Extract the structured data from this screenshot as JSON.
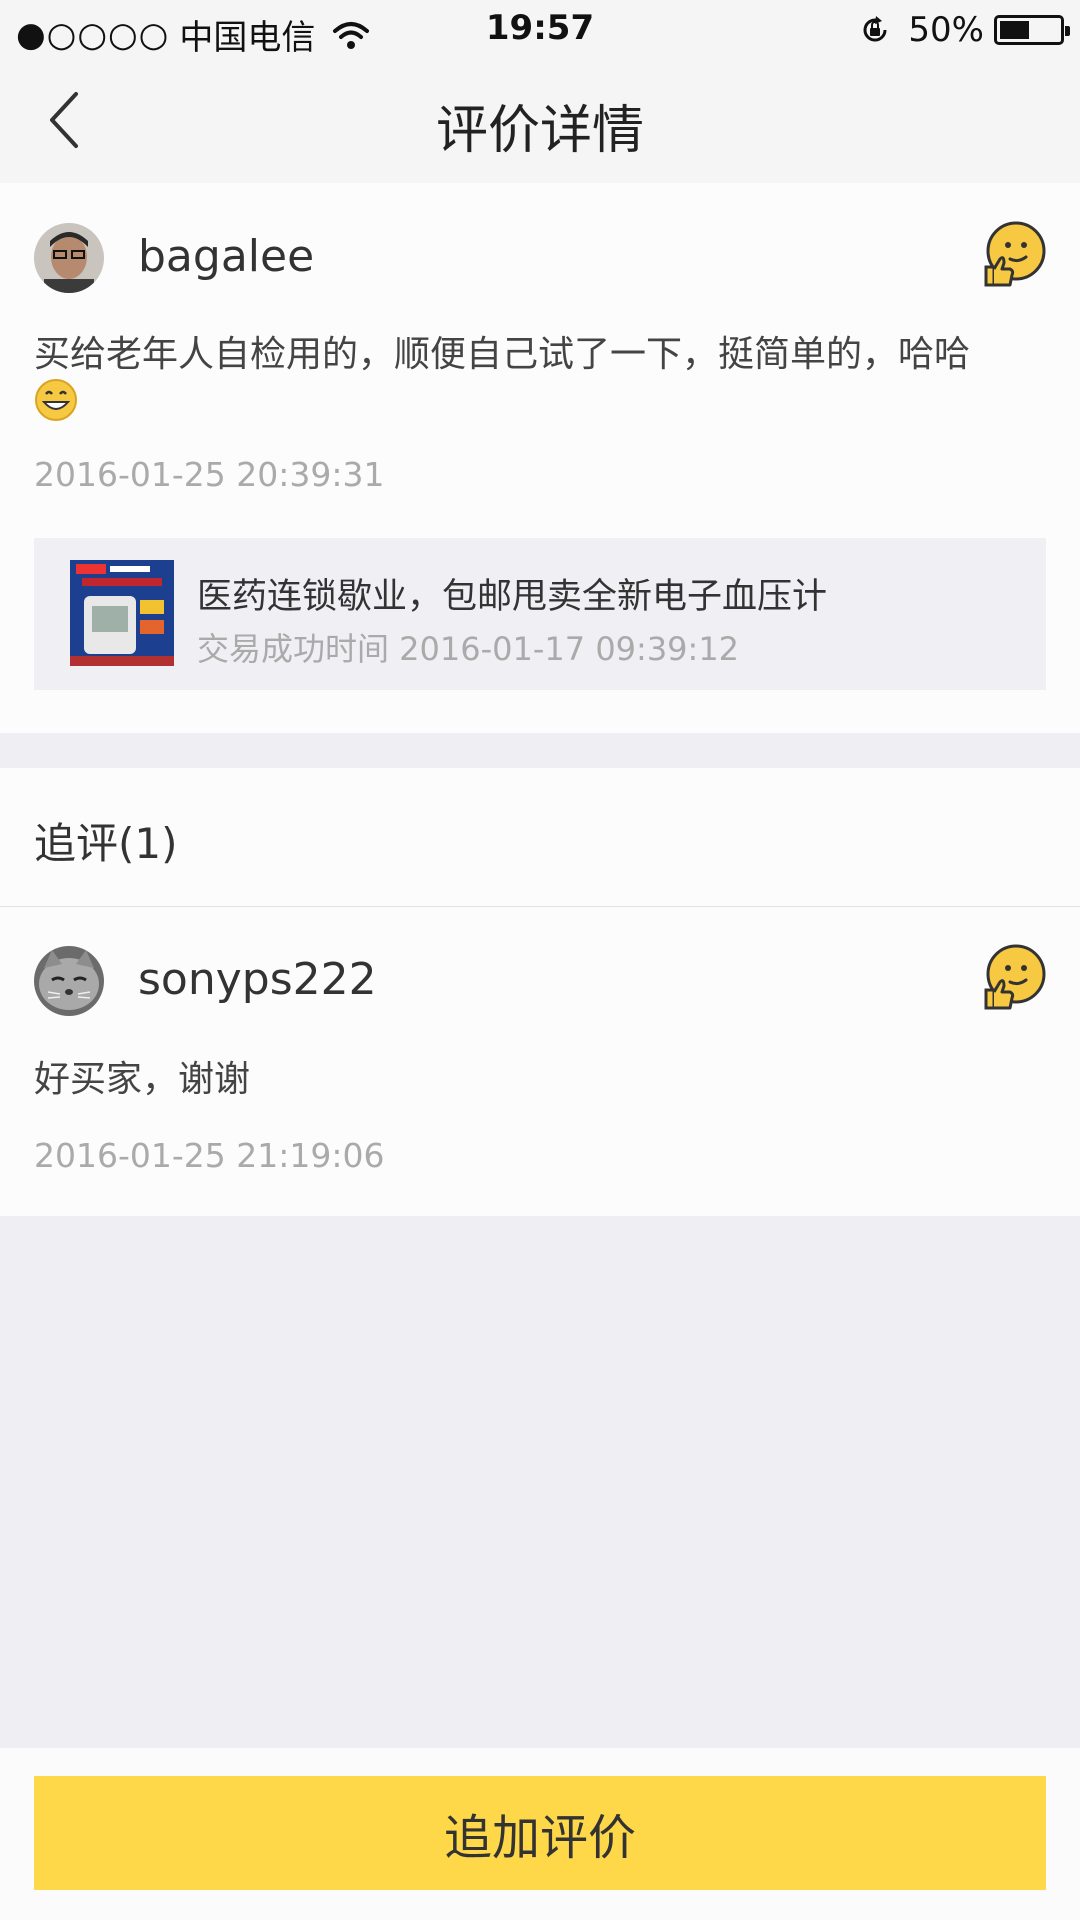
{
  "status_bar": {
    "signal": "●○○○○",
    "carrier": "中国电信",
    "time": "19:57",
    "battery_text": "50%",
    "battery_level": 0.5
  },
  "nav": {
    "title": "评价详情",
    "back_icon": "chevron-left-icon"
  },
  "review": {
    "username": "bagalee",
    "rating_icon": "thumbs-up-emoji-icon",
    "text": "买给老年人自检用的，顺便自己试了一下，挺简单的，哈哈",
    "inline_emoji": "grinning-face-icon",
    "timestamp": "2016-01-25 20:39:31",
    "product": {
      "title": "医药连锁歇业，包邮甩卖全新电子血压计",
      "deal_time": "交易成功时间 2016-01-17 09:39:12"
    }
  },
  "followup": {
    "header": "追评(1)",
    "username": "sonyps222",
    "rating_icon": "thumbs-up-emoji-icon",
    "text": "好买家，谢谢",
    "timestamp": "2016-01-25 21:19:06"
  },
  "footer": {
    "button_label": "追加评价"
  },
  "colors": {
    "accent": "#ffd84a",
    "page_bg": "#efeef2",
    "muted_text": "#aaaaaa"
  }
}
